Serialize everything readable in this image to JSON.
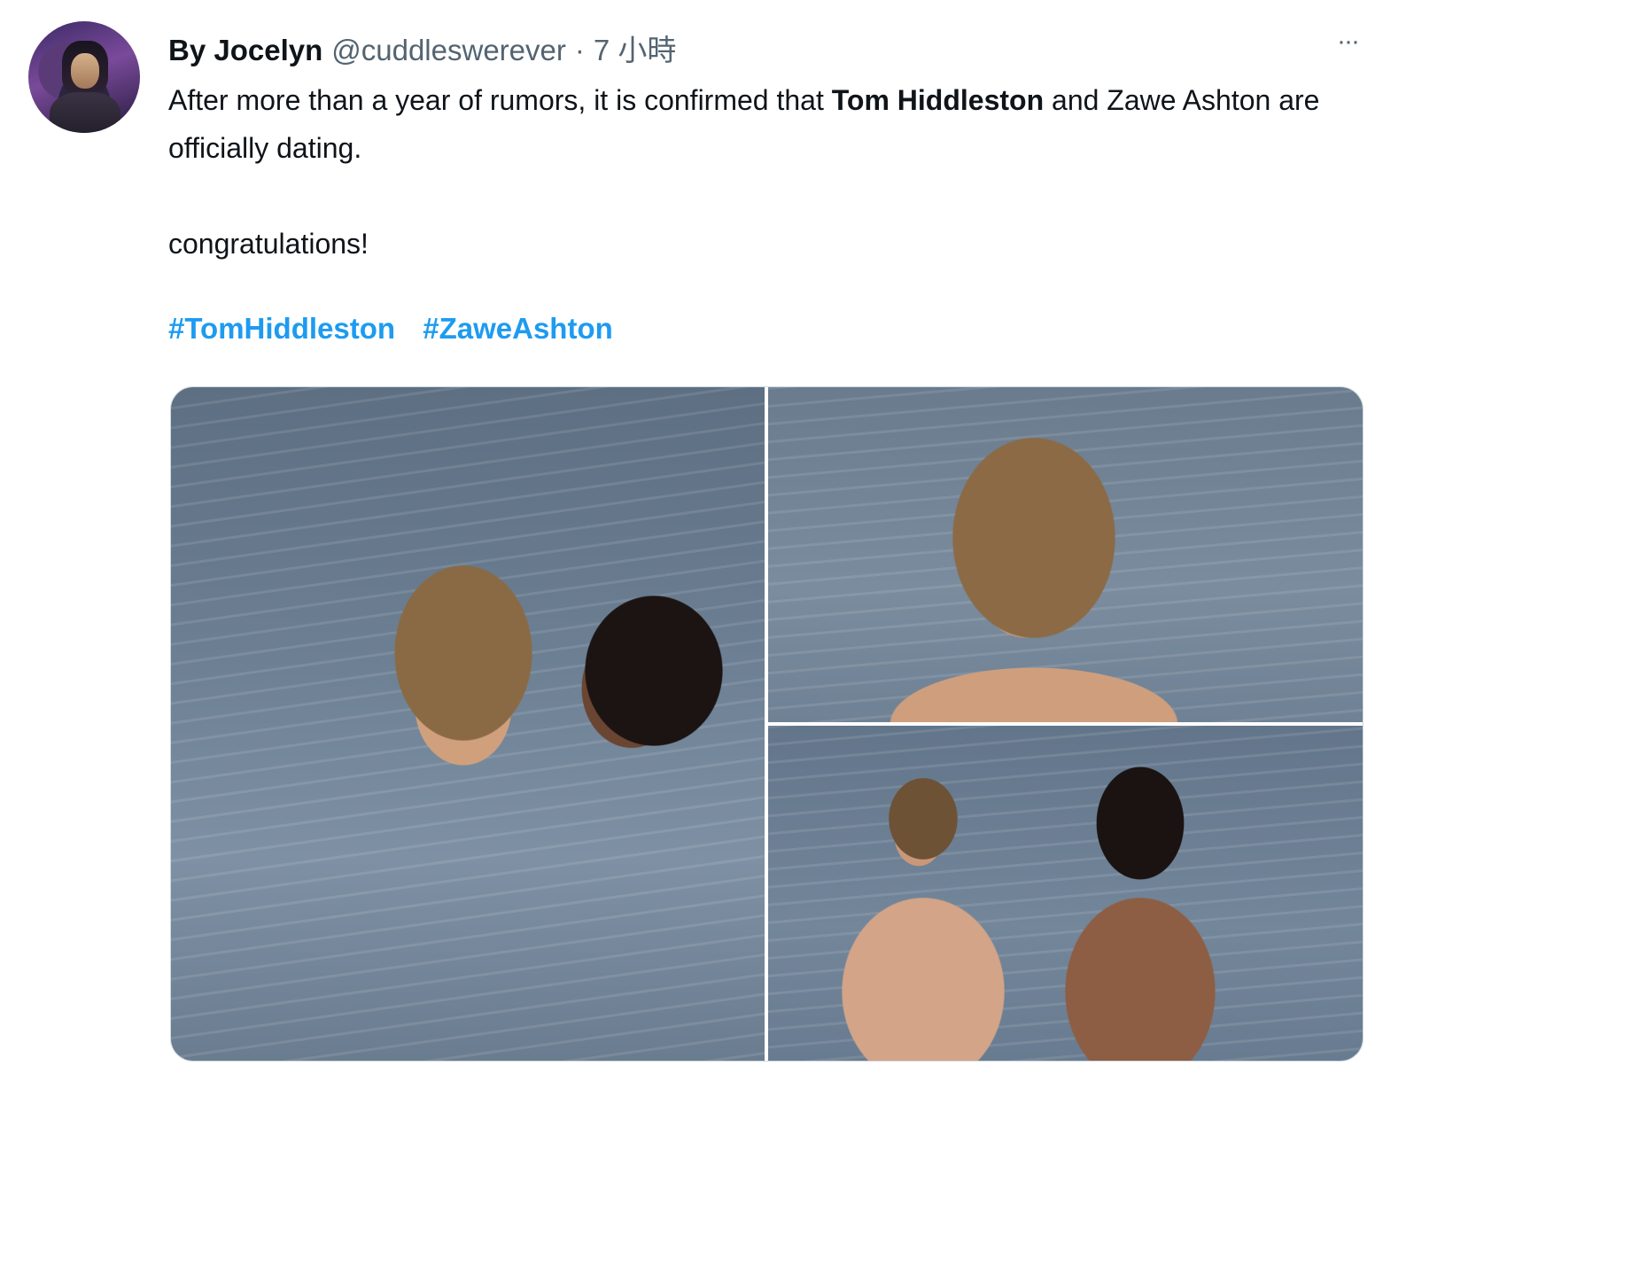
{
  "tweet": {
    "display_name": "By Jocelyn",
    "handle": "@cuddleswerever",
    "separator": "·",
    "time": "7 小時",
    "more_icon": "···",
    "text": {
      "p1_before": "After more than a year of rumors, it is confirmed that ",
      "p1_bold": "Tom Hiddleston",
      "p1_after": " and Zawe Ashton are officially dating.",
      "p2": "congratulations!"
    },
    "hashtags": [
      "#TomHiddleston",
      "#ZaweAshton"
    ]
  },
  "colors": {
    "link": "#1d9bf0",
    "secondary_text": "#536471",
    "primary_text": "#0f1419"
  },
  "icons": {
    "more": "more-horizontal-icon"
  }
}
